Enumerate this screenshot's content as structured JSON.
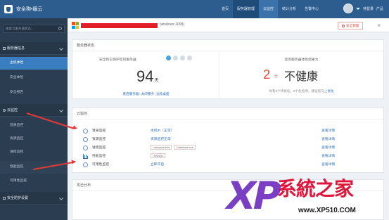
{
  "app": {
    "title": "安全狗•服云"
  },
  "topnav": {
    "items": [
      "首页",
      "服务器管理",
      "云监控",
      "统计分析",
      "告警中心"
    ],
    "active_index": 1,
    "highlight_index": 2,
    "user_label": "待登录",
    "extra": "产品"
  },
  "sidebar": {
    "search_placeholder": "搜索云服务器状态...",
    "groups": [
      {
        "label": "服务器信息",
        "items": [
          "主机体检",
          "安全体检",
          "安全报告"
        ],
        "active_item": 0
      },
      {
        "label": "云监控",
        "items": [
          "登录监控",
          "资源监控",
          "进程监控",
          "性能监控",
          "可用性监控"
        ],
        "selected_item": 3
      },
      {
        "label": "安全防护设置"
      }
    ]
  },
  "host": {
    "os": "(windows 2008)",
    "safe_button": "安全管理",
    "close_symbol": "×"
  },
  "server_status": {
    "title": "服务器状态",
    "protected_label": "安全狗已保护您的服务器",
    "protected_count": "94",
    "protected_unit": "天",
    "links": [
      "重启服务器",
      "关闭服务",
      "远程桌面"
    ],
    "health_label": "您的服务器体检结果为",
    "health_score": "2",
    "health_unit": "分",
    "health_text": "不健康",
    "tip_text": "你有9个待优化，5个危险项，建议您马上",
    "tip_link": "优化"
  },
  "cloud_monitor": {
    "title": "云监控",
    "rows": [
      {
        "name": "登录监控",
        "status": "本机IP（正常）",
        "link": "查看详情"
      },
      {
        "name": "资源监控",
        "status": "资源监控正常",
        "link": "查看详情"
      },
      {
        "name": "进程监控",
        "tags": [
          "services.exe",
          "taskhost.exe"
        ],
        "link": "查看详情"
      },
      {
        "name": "性能监控",
        "tags": [
          "MySQL"
        ],
        "link": "查看详情"
      },
      {
        "name": "可用性监控",
        "status": "立即开启",
        "link": "查看详情"
      }
    ]
  },
  "attack": {
    "title": "攻击分布"
  },
  "watermark": {
    "xp": "XP",
    "name": "系統之家",
    "url": "www.XP510.COM"
  },
  "colors": {
    "topbar": "#2d5d8f",
    "sidebar": "#2b3d50",
    "accent": "#3a7dc1",
    "alert": "#e74c3c",
    "link": "#2b72c2"
  }
}
